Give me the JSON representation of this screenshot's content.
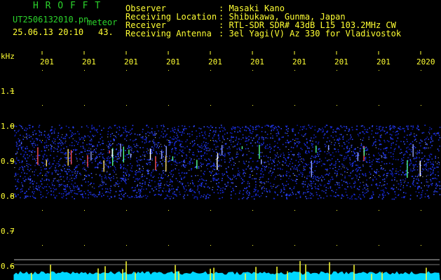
{
  "header": {
    "title": "H R O F F T",
    "filename": "UT2506132010.pn",
    "label_meteor": "meteor",
    "datetime": "25.06.13 20:10",
    "count": "43.",
    "info": [
      {
        "label": "Observer",
        "value": ": Masaki Kano"
      },
      {
        "label": "Receiving Location",
        "value": ": Shibukawa, Gunma, Japan"
      },
      {
        "label": "Receiver",
        "value": ": RTL-SDR SDR# 43dB L15 103.2MHz CW"
      },
      {
        "label": "Receiving Antenna",
        "value": ": 3el Yagi(V) Az 330 for Vladivostok"
      }
    ]
  },
  "axis": {
    "unit": "kHz",
    "labels": [
      "1.1",
      "1.0",
      "0.9",
      "0.8",
      "0.7",
      "0.6"
    ]
  },
  "time_ticks": [
    "201",
    "201",
    "201",
    "201",
    "201",
    "201",
    "201",
    "201",
    "201",
    "2020"
  ],
  "colors": {
    "text_green": "#2bd32b",
    "text_yellow": "#ffff33",
    "background": "#000000",
    "noise_band": "#1a2ad8",
    "spectrum": "#00d7ff"
  }
}
